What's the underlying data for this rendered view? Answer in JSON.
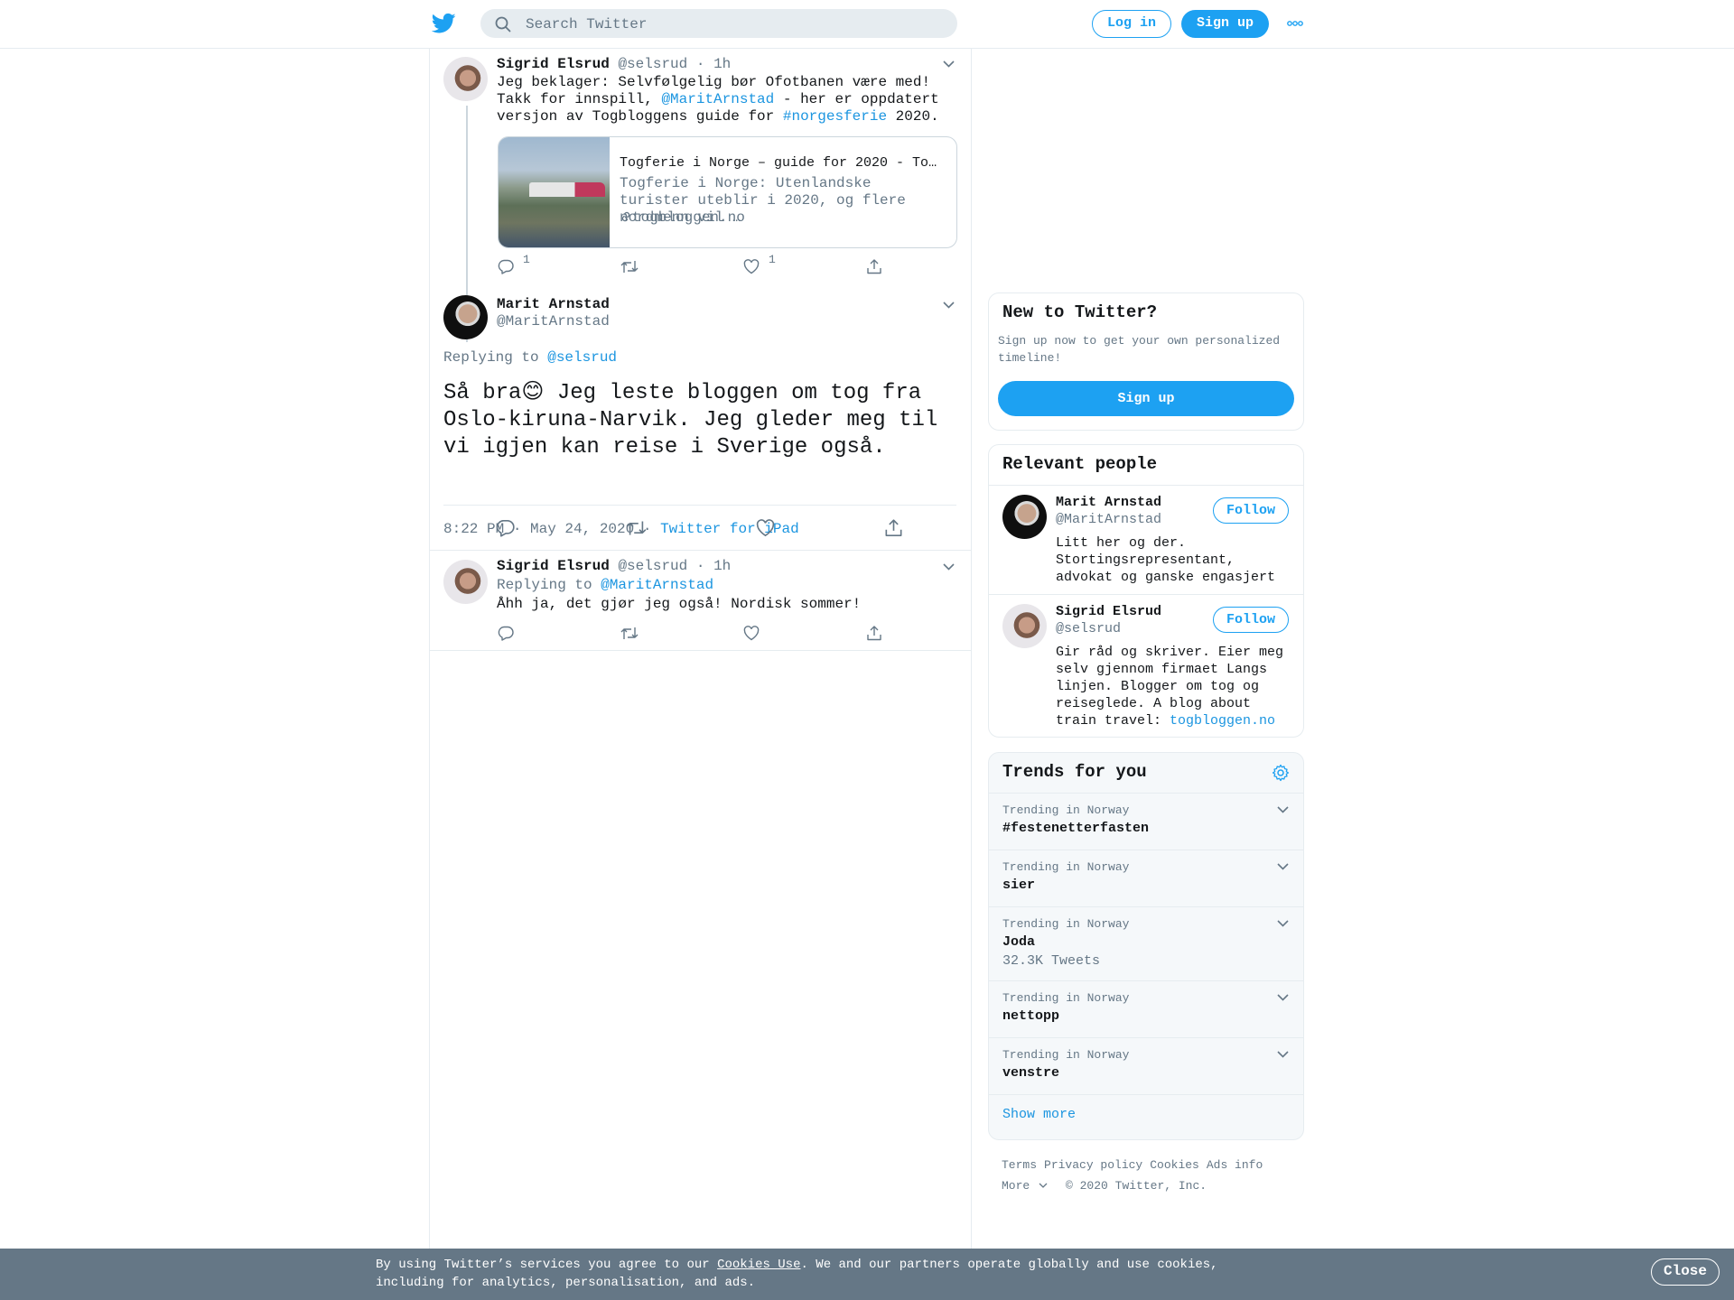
{
  "header": {
    "search_placeholder": "Search Twitter",
    "login_label": "Log in",
    "signup_label": "Sign up"
  },
  "colors": {
    "accent": "#1da1f2",
    "link": "#1b95e0",
    "muted": "#657786",
    "border": "#e6ecf0",
    "cookie_bar": "#657786"
  },
  "parent_tweet": {
    "name": "Sigrid Elsrud",
    "handle": "@selsrud",
    "time": "1h",
    "text_1": "Jeg beklager: Selvfølgelig bør Ofotbanen være med! Takk for innspill, ",
    "mention": "@MaritArnstad",
    "text_2": " - her er oppdatert versjon av Togbloggens guide for ",
    "hashtag": "#norgesferie",
    "text_3": " 2020.",
    "card": {
      "title": "Togferie i Norge – guide for 2020 - Togbloggen",
      "description": "Togferie i Norge: Utenlandske turister uteblir i 2020, og flere nordmenn vil …",
      "domain": "togbloggen.no"
    },
    "reply_count": "1",
    "like_count": "1"
  },
  "focus_tweet": {
    "name": "Marit Arnstad",
    "handle": "@MaritArnstad",
    "replying_prefix": "Replying to ",
    "replying_to": "@selsrud",
    "text_1": "Så bra",
    "emoji": "😊",
    "text_2": " Jeg leste bloggen om tog fra Oslo-kiruna-Narvik. Jeg gleder meg til vi igjen kan reise i Sverige også.",
    "timestamp": "8:22 PM · May 24, 2020",
    "source": "Twitter for iPad"
  },
  "reply_tweet": {
    "name": "Sigrid Elsrud",
    "handle": "@selsrud",
    "time": "1h",
    "replying_prefix": "Replying to ",
    "replying_to": "@MaritArnstad",
    "text": "Åhh ja, det gjør jeg også! Nordisk sommer!"
  },
  "new_to_twitter": {
    "title": "New to Twitter?",
    "subtitle": "Sign up now to get your own personalized timeline!",
    "button": "Sign up"
  },
  "relevant_people": {
    "title": "Relevant people",
    "follow_label": "Follow",
    "people": [
      {
        "name": "Marit Arnstad",
        "handle": "@MaritArnstad",
        "bio": "Litt her og der. Stortingsrepresentant, advokat og ganske engasjert"
      },
      {
        "name": "Sigrid Elsrud",
        "handle": "@selsrud",
        "bio": "Gir råd og skriver. Eier meg selv gjennom firmaet Langs linjen. Blogger om tog og reiseglede. A blog about train travel: ",
        "bio_link": "togbloggen.no"
      }
    ]
  },
  "trends": {
    "title": "Trends for you",
    "items": [
      {
        "label": "Trending in Norway",
        "name": "#festenetterfasten",
        "count": ""
      },
      {
        "label": "Trending in Norway",
        "name": "sier",
        "count": ""
      },
      {
        "label": "Trending in Norway",
        "name": "Joda",
        "count": "32.3K Tweets"
      },
      {
        "label": "Trending in Norway",
        "name": "nettopp",
        "count": ""
      },
      {
        "label": "Trending in Norway",
        "name": "venstre",
        "count": ""
      }
    ],
    "show_more": "Show more"
  },
  "footer": {
    "links": [
      "Terms",
      "Privacy policy",
      "Cookies",
      "Ads info"
    ],
    "more": "More",
    "copyright": "© 2020 Twitter, Inc."
  },
  "cookie_banner": {
    "text_1": "By using Twitter’s services you agree to our ",
    "link": "Cookies Use",
    "text_2": ". We and our partners operate globally and use cookies, including for analytics, personalisation, and ads.",
    "close": "Close"
  }
}
